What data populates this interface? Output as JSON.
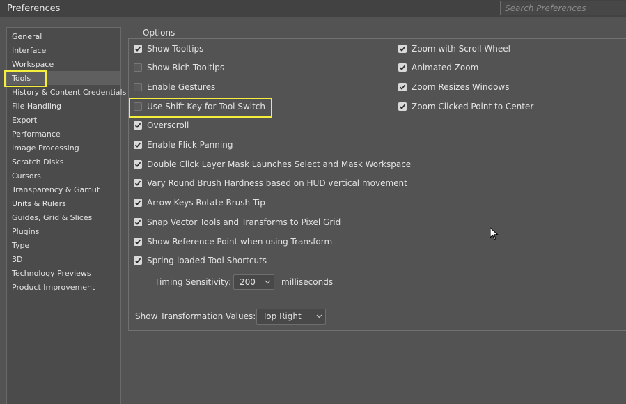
{
  "window": {
    "title": "Preferences"
  },
  "search": {
    "placeholder": "Search Preferences"
  },
  "sidebar": {
    "items": [
      {
        "label": "General"
      },
      {
        "label": "Interface"
      },
      {
        "label": "Workspace"
      },
      {
        "label": "Tools",
        "selected": true
      },
      {
        "label": "History & Content Credentials"
      },
      {
        "label": "File Handling"
      },
      {
        "label": "Export"
      },
      {
        "label": "Performance"
      },
      {
        "label": "Image Processing"
      },
      {
        "label": "Scratch Disks"
      },
      {
        "label": "Cursors"
      },
      {
        "label": "Transparency & Gamut"
      },
      {
        "label": "Units & Rulers"
      },
      {
        "label": "Guides, Grid & Slices"
      },
      {
        "label": "Plugins"
      },
      {
        "label": "Type"
      },
      {
        "label": "3D"
      },
      {
        "label": "Technology Previews"
      },
      {
        "label": "Product Improvement"
      }
    ]
  },
  "options": {
    "group_label": "Options",
    "left_column": [
      {
        "label": "Show Tooltips",
        "checked": true
      },
      {
        "label": "Show Rich Tooltips",
        "checked": false
      },
      {
        "label": "Enable Gestures",
        "checked": false
      },
      {
        "label": "Use Shift Key for Tool Switch",
        "checked": false
      },
      {
        "label": "Overscroll",
        "checked": true
      },
      {
        "label": "Enable Flick Panning",
        "checked": true
      },
      {
        "label": "Double Click Layer Mask Launches Select and Mask Workspace",
        "checked": true
      },
      {
        "label": "Vary Round Brush Hardness based on HUD vertical movement",
        "checked": true
      },
      {
        "label": "Arrow Keys Rotate Brush Tip",
        "checked": true
      },
      {
        "label": "Snap Vector Tools and Transforms to Pixel Grid",
        "checked": true
      },
      {
        "label": "Show Reference Point when using Transform",
        "checked": true
      },
      {
        "label": "Spring-loaded Tool Shortcuts",
        "checked": true
      }
    ],
    "right_column": [
      {
        "label": "Zoom with Scroll Wheel",
        "checked": true
      },
      {
        "label": "Animated Zoom",
        "checked": true
      },
      {
        "label": "Zoom Resizes Windows",
        "checked": true
      },
      {
        "label": "Zoom Clicked Point to Center",
        "checked": true
      }
    ],
    "timing_sensitivity": {
      "label": "Timing Sensitivity:",
      "value": "200",
      "unit": "milliseconds"
    },
    "transformation_values": {
      "label": "Show Transformation Values:",
      "value": "Top Right"
    }
  }
}
